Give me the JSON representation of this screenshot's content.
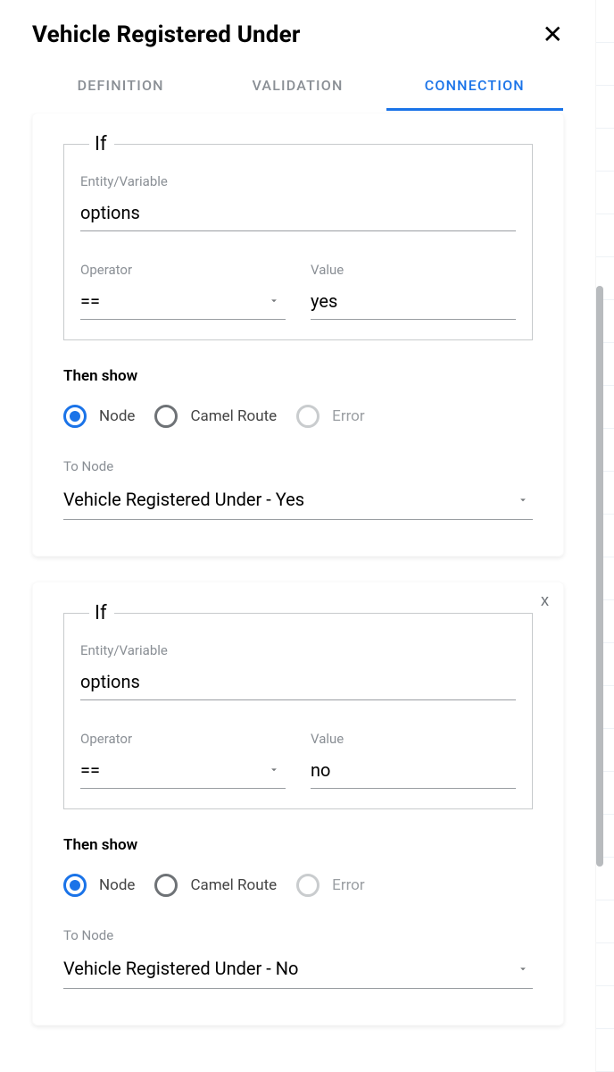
{
  "header": {
    "title": "Vehicle Registered Under"
  },
  "tabs": [
    {
      "label": "DEFINITION",
      "active": false
    },
    {
      "label": "VALIDATION",
      "active": false
    },
    {
      "label": "CONNECTION",
      "active": true
    }
  ],
  "conditions": [
    {
      "if_label": "If",
      "entity_label": "Entity/Variable",
      "entity_value": "options",
      "operator_label": "Operator",
      "operator_value": "==",
      "value_label": "Value",
      "value_value": "yes",
      "then_show_label": "Then show",
      "radios": {
        "node": "Node",
        "camel_route": "Camel Route",
        "error": "Error",
        "selected": "node"
      },
      "to_node_label": "To Node",
      "to_node_value": "Vehicle Registered Under - Yes",
      "show_close": false
    },
    {
      "if_label": "If",
      "entity_label": "Entity/Variable",
      "entity_value": "options",
      "operator_label": "Operator",
      "operator_value": "==",
      "value_label": "Value",
      "value_value": "no",
      "then_show_label": "Then show",
      "radios": {
        "node": "Node",
        "camel_route": "Camel Route",
        "error": "Error",
        "selected": "node"
      },
      "to_node_label": "To Node",
      "to_node_value": "Vehicle Registered Under - No",
      "show_close": true
    }
  ]
}
